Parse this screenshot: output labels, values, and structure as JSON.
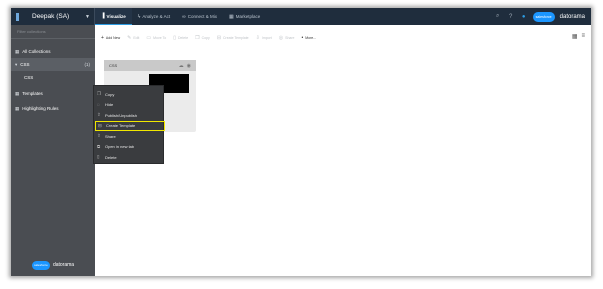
{
  "topbar": {
    "workspace": "Deepak (SA)",
    "nav": [
      {
        "label": "Visualize",
        "icon": "chart-icon"
      },
      {
        "label": "Analyze & Act",
        "icon": "bolt-icon"
      },
      {
        "label": "Connect & Mix",
        "icon": "link-icon"
      },
      {
        "label": "Marketplace",
        "icon": "grid-icon"
      }
    ],
    "brand": "datorama",
    "sf_logo": "salesforce"
  },
  "sidebar": {
    "search_placeholder": "Filter collections",
    "items": [
      {
        "label": "All Collections",
        "icon": "grid-icon"
      },
      {
        "label": "CSS",
        "count": "(1)",
        "icon": "chevron-down-icon"
      },
      {
        "label": "Templates",
        "icon": "grid-icon"
      },
      {
        "label": "Highlighting Rules",
        "icon": "grid-icon"
      }
    ],
    "sub_item": "CSS",
    "footer_brand": "datorama",
    "footer_logo": "salesforce"
  },
  "toolbar": {
    "items": [
      "Add New",
      "Edit",
      "Move To",
      "Delete",
      "Copy",
      "Create Template",
      "Import",
      "Share",
      "More..."
    ]
  },
  "card": {
    "title": "CSS"
  },
  "menu": {
    "items": [
      {
        "label": "Copy",
        "icon": "copy-icon"
      },
      {
        "label": "Hide",
        "icon": "eye-slash-icon"
      },
      {
        "label": "Publish/Unpublish",
        "icon": "publish-icon"
      },
      {
        "label": "Create Template",
        "icon": "template-icon"
      },
      {
        "label": "Share",
        "icon": "share-icon"
      },
      {
        "label": "Open in new tab",
        "icon": "external-icon"
      },
      {
        "label": "Delete",
        "icon": "trash-icon"
      }
    ],
    "highlight_color": "#f0e700"
  }
}
